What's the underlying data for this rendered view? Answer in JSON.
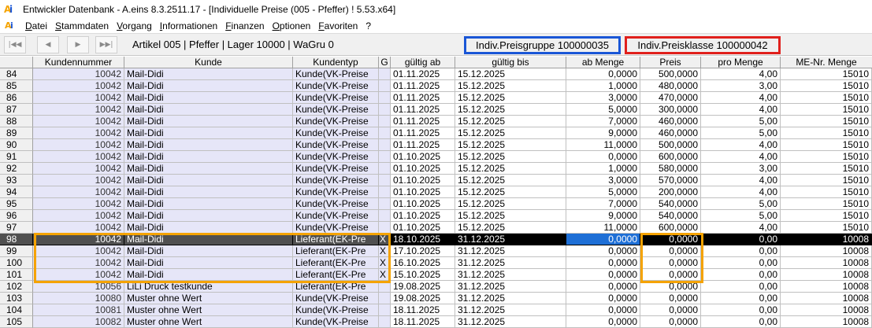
{
  "window": {
    "title": "Entwickler Datenbank - A.eins 8.3.2511.17 - [Individuelle Preise (005 - Pfeffer) ! 5.53.x64]"
  },
  "menu": [
    "Datei",
    "Stammdaten",
    "Vorgang",
    "Informationen",
    "Finanzen",
    "Optionen",
    "Favoriten",
    "?"
  ],
  "navbar": {
    "article_info": "Artikel 005 | Pfeffer | Lager 10000 | WaGru 0",
    "preisgruppe": "Indiv.Preisgruppe 100000035",
    "preisklasse": "Indiv.Preisklasse 100000042"
  },
  "colors": {
    "preisgruppe_border": "#1a56d6",
    "preisklasse_border": "#e0201c",
    "highlight": "#f5a300",
    "selected_row": "#000000",
    "focus_cell": "#1e6fd6"
  },
  "table": {
    "columns": [
      "",
      "Kundennummer",
      "Kunde",
      "Kundentyp",
      "G",
      "gültig ab",
      "gültig bis",
      "ab Menge",
      "Preis",
      "pro Menge",
      "ME-Nr. Menge"
    ],
    "selected_row": "98",
    "rows": [
      [
        "84",
        "10042",
        "Mail-Didi",
        "Kunde(VK-Preise",
        "",
        "01.11.2025",
        "15.12.2025",
        "0,0000",
        "500,0000",
        "4,00",
        "15010"
      ],
      [
        "85",
        "10042",
        "Mail-Didi",
        "Kunde(VK-Preise",
        "",
        "01.11.2025",
        "15.12.2025",
        "1,0000",
        "480,0000",
        "3,00",
        "15010"
      ],
      [
        "86",
        "10042",
        "Mail-Didi",
        "Kunde(VK-Preise",
        "",
        "01.11.2025",
        "15.12.2025",
        "3,0000",
        "470,0000",
        "4,00",
        "15010"
      ],
      [
        "87",
        "10042",
        "Mail-Didi",
        "Kunde(VK-Preise",
        "",
        "01.11.2025",
        "15.12.2025",
        "5,0000",
        "300,0000",
        "4,00",
        "15010"
      ],
      [
        "88",
        "10042",
        "Mail-Didi",
        "Kunde(VK-Preise",
        "",
        "01.11.2025",
        "15.12.2025",
        "7,0000",
        "460,0000",
        "5,00",
        "15010"
      ],
      [
        "89",
        "10042",
        "Mail-Didi",
        "Kunde(VK-Preise",
        "",
        "01.11.2025",
        "15.12.2025",
        "9,0000",
        "460,0000",
        "5,00",
        "15010"
      ],
      [
        "90",
        "10042",
        "Mail-Didi",
        "Kunde(VK-Preise",
        "",
        "01.11.2025",
        "15.12.2025",
        "11,0000",
        "500,0000",
        "4,00",
        "15010"
      ],
      [
        "91",
        "10042",
        "Mail-Didi",
        "Kunde(VK-Preise",
        "",
        "01.10.2025",
        "15.12.2025",
        "0,0000",
        "600,0000",
        "4,00",
        "15010"
      ],
      [
        "92",
        "10042",
        "Mail-Didi",
        "Kunde(VK-Preise",
        "",
        "01.10.2025",
        "15.12.2025",
        "1,0000",
        "580,0000",
        "3,00",
        "15010"
      ],
      [
        "93",
        "10042",
        "Mail-Didi",
        "Kunde(VK-Preise",
        "",
        "01.10.2025",
        "15.12.2025",
        "3,0000",
        "570,0000",
        "4,00",
        "15010"
      ],
      [
        "94",
        "10042",
        "Mail-Didi",
        "Kunde(VK-Preise",
        "",
        "01.10.2025",
        "15.12.2025",
        "5,0000",
        "200,0000",
        "4,00",
        "15010"
      ],
      [
        "95",
        "10042",
        "Mail-Didi",
        "Kunde(VK-Preise",
        "",
        "01.10.2025",
        "15.12.2025",
        "7,0000",
        "540,0000",
        "5,00",
        "15010"
      ],
      [
        "96",
        "10042",
        "Mail-Didi",
        "Kunde(VK-Preise",
        "",
        "01.10.2025",
        "15.12.2025",
        "9,0000",
        "540,0000",
        "5,00",
        "15010"
      ],
      [
        "97",
        "10042",
        "Mail-Didi",
        "Kunde(VK-Preise",
        "",
        "01.10.2025",
        "15.12.2025",
        "11,0000",
        "600,0000",
        "4,00",
        "15010"
      ],
      [
        "98",
        "10042",
        "Mail-Didi",
        "Lieferant(EK-Pre",
        "X",
        "18.10.2025",
        "31.12.2025",
        "0,0000",
        "0,0000",
        "0,00",
        "10008"
      ],
      [
        "99",
        "10042",
        "Mail-Didi",
        "Lieferant(EK-Pre",
        "X",
        "17.10.2025",
        "31.12.2025",
        "0,0000",
        "0,0000",
        "0,00",
        "10008"
      ],
      [
        "100",
        "10042",
        "Mail-Didi",
        "Lieferant(EK-Pre",
        "X",
        "16.10.2025",
        "31.12.2025",
        "0,0000",
        "0,0000",
        "0,00",
        "10008"
      ],
      [
        "101",
        "10042",
        "Mail-Didi",
        "Lieferant(EK-Pre",
        "X",
        "15.10.2025",
        "31.12.2025",
        "0,0000",
        "0,0000",
        "0,00",
        "10008"
      ],
      [
        "102",
        "10056",
        "LiLi Druck testkunde",
        "Lieferant(EK-Pre",
        "",
        "19.08.2025",
        "31.12.2025",
        "0,0000",
        "0,0000",
        "0,00",
        "10008"
      ],
      [
        "103",
        "10080",
        "Muster ohne Wert",
        "Kunde(VK-Preise",
        "",
        "19.08.2025",
        "31.12.2025",
        "0,0000",
        "0,0000",
        "0,00",
        "10008"
      ],
      [
        "104",
        "10081",
        "Muster ohne Wert",
        "Kunde(VK-Preise",
        "",
        "18.11.2025",
        "31.12.2025",
        "0,0000",
        "0,0000",
        "0,00",
        "10008"
      ],
      [
        "105",
        "10082",
        "Muster ohne Wert",
        "Kunde(VK-Preise",
        "",
        "18.11.2025",
        "31.12.2025",
        "0,0000",
        "0,0000",
        "0,00",
        "10008"
      ]
    ]
  }
}
